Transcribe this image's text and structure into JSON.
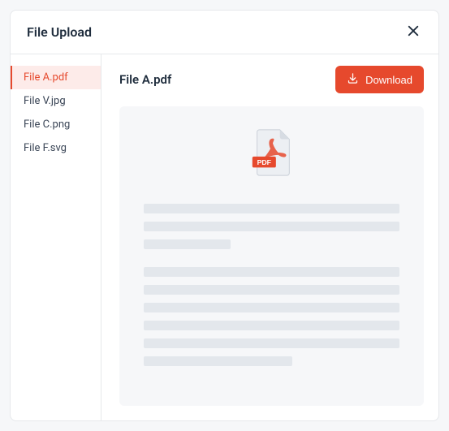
{
  "header": {
    "title": "File Upload"
  },
  "sidebar": {
    "items": [
      {
        "label": "File A.pdf",
        "active": true
      },
      {
        "label": "File V.jpg",
        "active": false
      },
      {
        "label": "File C.png",
        "active": false
      },
      {
        "label": "File F.svg",
        "active": false
      }
    ]
  },
  "main": {
    "filename": "File A.pdf",
    "download_label": "Download",
    "file_badge": "PDF"
  },
  "colors": {
    "accent": "#e6492d",
    "accent_bg": "#fdebe9",
    "border": "#e6e8eb",
    "preview_bg": "#f6f7f9",
    "placeholder": "#e3e7ec",
    "text_primary": "#1f2d3d"
  }
}
